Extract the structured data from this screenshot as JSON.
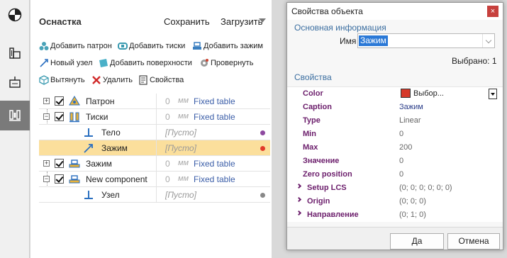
{
  "panel": {
    "title": "Оснастка",
    "save_label": "Сохранить",
    "load_label": "Загрузить"
  },
  "toolbar": {
    "add_chuck": "Добавить патрон",
    "add_vise": "Добавить тиски",
    "add_clamp": "Добавить зажим",
    "new_node": "Новый узел",
    "add_surfaces": "Добавить поверхности",
    "rotate": "Провернуть",
    "extrude": "Вытянуть",
    "delete": "Удалить",
    "properties": "Свойства"
  },
  "tree": {
    "rows": [
      {
        "label": "Патрон",
        "value": "0",
        "unit": "мм",
        "link": "Fixed table"
      },
      {
        "label": "Тиски",
        "value": "0",
        "unit": "мм",
        "link": "Fixed table"
      },
      {
        "label": "Тело",
        "empty": "[Пусто]",
        "dot_color": "#8e4aa0"
      },
      {
        "label": "Зажим",
        "empty": "[Пусто]",
        "dot_color": "#e23a2a"
      },
      {
        "label": "Зажим",
        "value": "0",
        "unit": "мм",
        "link": "Fixed table"
      },
      {
        "label": "New component",
        "value": "0",
        "unit": "мм",
        "link": "Fixed table"
      },
      {
        "label": "Узел",
        "empty": "[Пусто]",
        "dot_color": "#888888"
      }
    ]
  },
  "dialog": {
    "title": "Свойства объекта",
    "close_glyph": "×",
    "basic_section": "Основная информация",
    "name_label": "Имя",
    "name_value": "Зажим",
    "selected_text": "Выбрано: 1",
    "props_section": "Свойства",
    "properties": [
      {
        "key": "Color",
        "value": "Выбор...",
        "color": "#d63a2b"
      },
      {
        "key": "Caption",
        "value": "Зажим"
      },
      {
        "key": "Type",
        "value": "Linear"
      },
      {
        "key": "Min",
        "value": "0"
      },
      {
        "key": "Max",
        "value": "200"
      },
      {
        "key": "Значение",
        "value": "0"
      },
      {
        "key": "Zero position",
        "value": "0"
      },
      {
        "key": "Setup LCS",
        "value": "(0; 0; 0; 0; 0; 0)"
      },
      {
        "key": "Origin",
        "value": "(0; 0; 0)"
      },
      {
        "key": "Направление",
        "value": "(0; 1; 0)"
      }
    ],
    "ok_label": "Да",
    "cancel_label": "Отмена"
  }
}
